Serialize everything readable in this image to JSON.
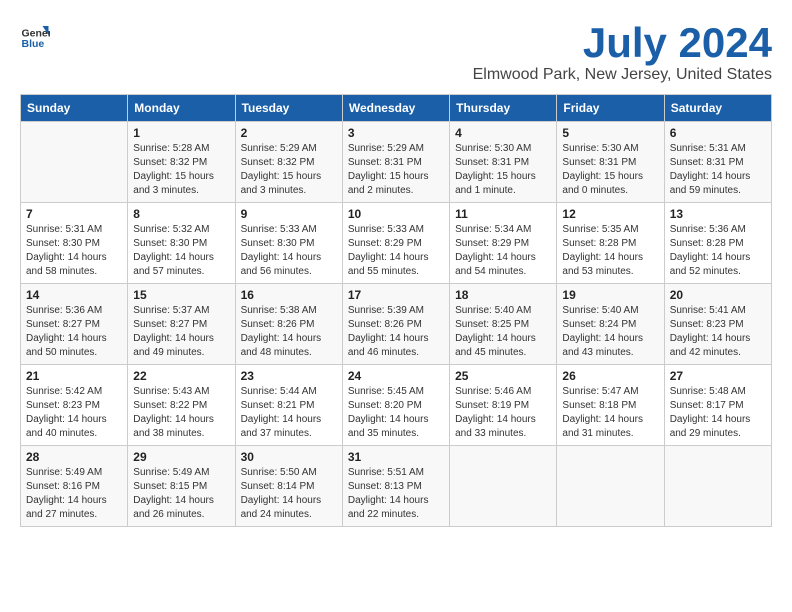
{
  "header": {
    "logo_general": "General",
    "logo_blue": "Blue",
    "month_title": "July 2024",
    "location": "Elmwood Park, New Jersey, United States"
  },
  "days_of_week": [
    "Sunday",
    "Monday",
    "Tuesday",
    "Wednesday",
    "Thursday",
    "Friday",
    "Saturday"
  ],
  "weeks": [
    [
      {
        "day": "",
        "info": ""
      },
      {
        "day": "1",
        "info": "Sunrise: 5:28 AM\nSunset: 8:32 PM\nDaylight: 15 hours\nand 3 minutes."
      },
      {
        "day": "2",
        "info": "Sunrise: 5:29 AM\nSunset: 8:32 PM\nDaylight: 15 hours\nand 3 minutes."
      },
      {
        "day": "3",
        "info": "Sunrise: 5:29 AM\nSunset: 8:31 PM\nDaylight: 15 hours\nand 2 minutes."
      },
      {
        "day": "4",
        "info": "Sunrise: 5:30 AM\nSunset: 8:31 PM\nDaylight: 15 hours\nand 1 minute."
      },
      {
        "day": "5",
        "info": "Sunrise: 5:30 AM\nSunset: 8:31 PM\nDaylight: 15 hours\nand 0 minutes."
      },
      {
        "day": "6",
        "info": "Sunrise: 5:31 AM\nSunset: 8:31 PM\nDaylight: 14 hours\nand 59 minutes."
      }
    ],
    [
      {
        "day": "7",
        "info": "Sunrise: 5:31 AM\nSunset: 8:30 PM\nDaylight: 14 hours\nand 58 minutes."
      },
      {
        "day": "8",
        "info": "Sunrise: 5:32 AM\nSunset: 8:30 PM\nDaylight: 14 hours\nand 57 minutes."
      },
      {
        "day": "9",
        "info": "Sunrise: 5:33 AM\nSunset: 8:30 PM\nDaylight: 14 hours\nand 56 minutes."
      },
      {
        "day": "10",
        "info": "Sunrise: 5:33 AM\nSunset: 8:29 PM\nDaylight: 14 hours\nand 55 minutes."
      },
      {
        "day": "11",
        "info": "Sunrise: 5:34 AM\nSunset: 8:29 PM\nDaylight: 14 hours\nand 54 minutes."
      },
      {
        "day": "12",
        "info": "Sunrise: 5:35 AM\nSunset: 8:28 PM\nDaylight: 14 hours\nand 53 minutes."
      },
      {
        "day": "13",
        "info": "Sunrise: 5:36 AM\nSunset: 8:28 PM\nDaylight: 14 hours\nand 52 minutes."
      }
    ],
    [
      {
        "day": "14",
        "info": "Sunrise: 5:36 AM\nSunset: 8:27 PM\nDaylight: 14 hours\nand 50 minutes."
      },
      {
        "day": "15",
        "info": "Sunrise: 5:37 AM\nSunset: 8:27 PM\nDaylight: 14 hours\nand 49 minutes."
      },
      {
        "day": "16",
        "info": "Sunrise: 5:38 AM\nSunset: 8:26 PM\nDaylight: 14 hours\nand 48 minutes."
      },
      {
        "day": "17",
        "info": "Sunrise: 5:39 AM\nSunset: 8:26 PM\nDaylight: 14 hours\nand 46 minutes."
      },
      {
        "day": "18",
        "info": "Sunrise: 5:40 AM\nSunset: 8:25 PM\nDaylight: 14 hours\nand 45 minutes."
      },
      {
        "day": "19",
        "info": "Sunrise: 5:40 AM\nSunset: 8:24 PM\nDaylight: 14 hours\nand 43 minutes."
      },
      {
        "day": "20",
        "info": "Sunrise: 5:41 AM\nSunset: 8:23 PM\nDaylight: 14 hours\nand 42 minutes."
      }
    ],
    [
      {
        "day": "21",
        "info": "Sunrise: 5:42 AM\nSunset: 8:23 PM\nDaylight: 14 hours\nand 40 minutes."
      },
      {
        "day": "22",
        "info": "Sunrise: 5:43 AM\nSunset: 8:22 PM\nDaylight: 14 hours\nand 38 minutes."
      },
      {
        "day": "23",
        "info": "Sunrise: 5:44 AM\nSunset: 8:21 PM\nDaylight: 14 hours\nand 37 minutes."
      },
      {
        "day": "24",
        "info": "Sunrise: 5:45 AM\nSunset: 8:20 PM\nDaylight: 14 hours\nand 35 minutes."
      },
      {
        "day": "25",
        "info": "Sunrise: 5:46 AM\nSunset: 8:19 PM\nDaylight: 14 hours\nand 33 minutes."
      },
      {
        "day": "26",
        "info": "Sunrise: 5:47 AM\nSunset: 8:18 PM\nDaylight: 14 hours\nand 31 minutes."
      },
      {
        "day": "27",
        "info": "Sunrise: 5:48 AM\nSunset: 8:17 PM\nDaylight: 14 hours\nand 29 minutes."
      }
    ],
    [
      {
        "day": "28",
        "info": "Sunrise: 5:49 AM\nSunset: 8:16 PM\nDaylight: 14 hours\nand 27 minutes."
      },
      {
        "day": "29",
        "info": "Sunrise: 5:49 AM\nSunset: 8:15 PM\nDaylight: 14 hours\nand 26 minutes."
      },
      {
        "day": "30",
        "info": "Sunrise: 5:50 AM\nSunset: 8:14 PM\nDaylight: 14 hours\nand 24 minutes."
      },
      {
        "day": "31",
        "info": "Sunrise: 5:51 AM\nSunset: 8:13 PM\nDaylight: 14 hours\nand 22 minutes."
      },
      {
        "day": "",
        "info": ""
      },
      {
        "day": "",
        "info": ""
      },
      {
        "day": "",
        "info": ""
      }
    ]
  ]
}
